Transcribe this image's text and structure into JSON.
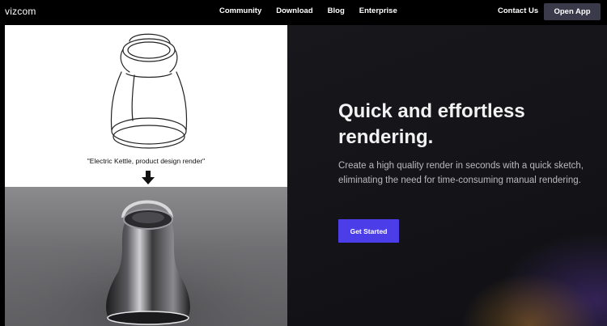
{
  "nav": {
    "logo": "vizcom",
    "links": [
      "Community",
      "Download",
      "Blog",
      "Enterprise"
    ],
    "contact": "Contact Us",
    "open_app": "Open App"
  },
  "demo": {
    "prompt": "\"Electric Kettle, product design render\"",
    "sketch_icon": "kettle-sketch",
    "arrow_icon": "arrow-down-icon",
    "render_icon": "kettle-render"
  },
  "hero": {
    "title": "Quick and effortless rendering.",
    "description": "Create a high quality render in seconds with a quick sketch, eliminating the need for time-consuming manual rendering.",
    "cta": "Get Started"
  },
  "colors": {
    "background": "#000000",
    "cta": "#4b3ee8",
    "open_app_button": "#3b3a4a",
    "hero_text": "#f2f2f2",
    "hero_desc": "#b9b9c0"
  }
}
